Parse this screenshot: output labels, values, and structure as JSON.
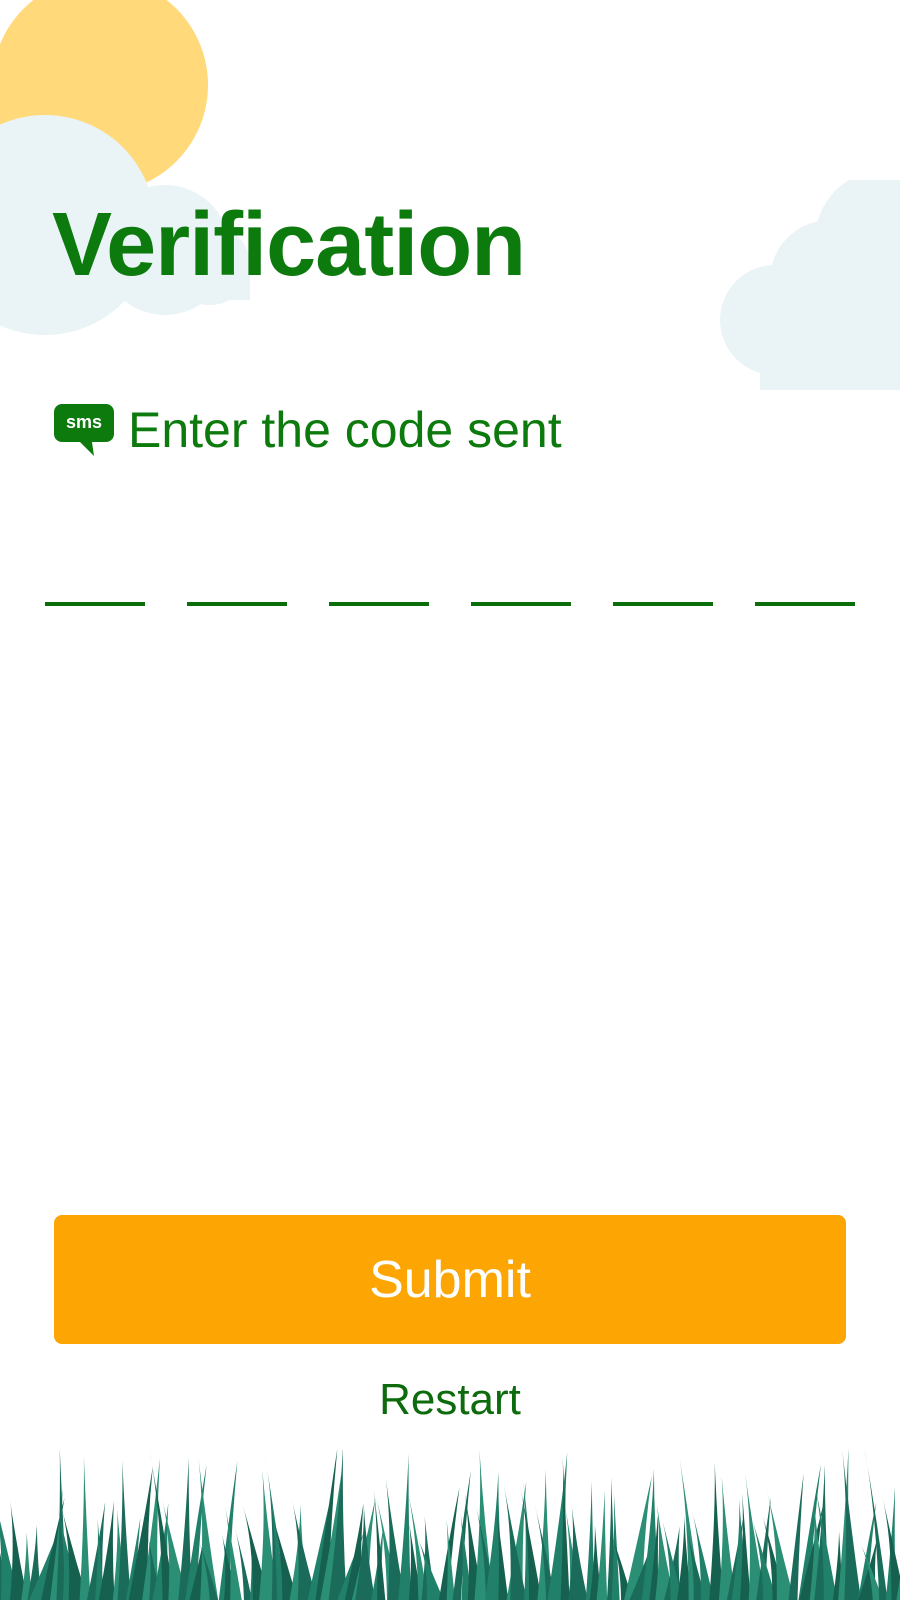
{
  "title": "Verification",
  "instruction": {
    "icon": "sms-icon",
    "icon_label": "sms",
    "text": "Enter the code sent"
  },
  "code_inputs": [
    "",
    "",
    "",
    "",
    "",
    ""
  ],
  "submit_label": "Submit",
  "restart_label": "Restart",
  "colors": {
    "primary_green": "#0d7a0d",
    "submit_orange": "#fca503",
    "sun_yellow": "#ffd97a",
    "cloud": "#eaf4f7",
    "grass": "#1a6b5a"
  }
}
